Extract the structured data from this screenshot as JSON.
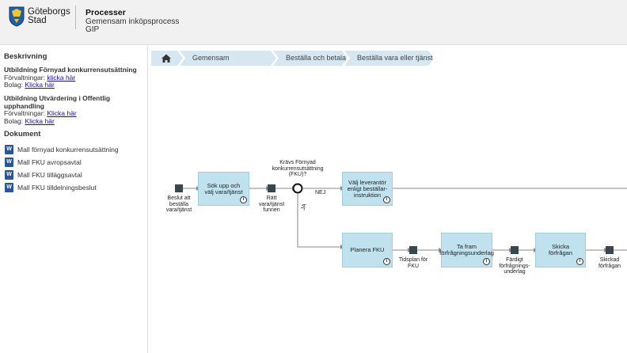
{
  "header": {
    "logo_line1": "Göteborgs",
    "logo_line2": "Stad",
    "title": "Processer",
    "subtitle": "Gemensam inköpsprocess",
    "code": "GIP"
  },
  "sidebar": {
    "description_heading": "Beskrivning",
    "block1": {
      "title": "Utbildning Förnyad konkurrensutsättning",
      "row1_label": "Förvaltningar: ",
      "row1_link": "klicka här",
      "row2_label": "Bolag: ",
      "row2_link": "Klicka här"
    },
    "block2": {
      "title_line1": "Utbildning Utvärdering i Offentlig",
      "title_line2": "upphandling",
      "row1_label": "Förvaltningar: ",
      "row1_link": "Klicka här",
      "row2_label": "Bolag: ",
      "row2_link": "Klicka här"
    },
    "documents_heading": "Dokument",
    "documents": [
      {
        "label": "Mall förnyad konkurrensutsättning",
        "icon": "word-document-icon"
      },
      {
        "label": "Mall FKU avropsavtal",
        "icon": "word-document-icon"
      },
      {
        "label": "Mall FKU tilläggsavtal",
        "icon": "word-document-icon"
      },
      {
        "label": "Mall FKU tilldelningsbeslut",
        "icon": "word-document-icon"
      }
    ]
  },
  "breadcrumb": {
    "home_icon": "home-icon",
    "items": [
      "Gemensam inköpsprocess",
      "Beställa och betala",
      "Beställa vara eller tjänst"
    ]
  },
  "diagram": {
    "start_event": "Beslut att beställa vara/tjänst",
    "task_search": "Sök upp och välj vara/tjänst",
    "event_found": "Rätt vara/tjänst funnen",
    "gateway_question": "Krävs Förnyad konkurrensutsättning (FKU)?",
    "label_no": "NEJ",
    "label_yes": "JA",
    "task_supplier": "Välj leverantör enligt beställar-instruktion",
    "task_plan": "Planera FKU",
    "event_timeplan": "Tidsplan för FKU",
    "task_prepare": "Ta fram förfrågningsunderlag",
    "event_ready": "Färdigt förfrågnings-underlag",
    "task_send": "Skicka förfrågan",
    "event_sent": "Skickad förfrågan",
    "info_glyph": "i",
    "colors": {
      "task_fill": "#bfe2ee",
      "event_fill": "#37474f",
      "line": "#8a8a8a"
    }
  }
}
